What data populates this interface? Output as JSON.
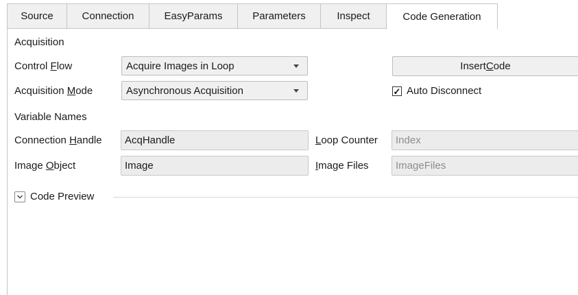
{
  "tabs": [
    {
      "label": "Source"
    },
    {
      "label": "Connection"
    },
    {
      "label": "EasyParams"
    },
    {
      "label": "Parameters"
    },
    {
      "label": "Inspect"
    },
    {
      "label": "Code Generation",
      "active": true
    }
  ],
  "acquisition": {
    "section_label": "Acquisition",
    "control_flow": {
      "label_pre": "Control ",
      "label_key": "F",
      "label_post": "low",
      "value": "Acquire Images in Loop"
    },
    "acquisition_mode": {
      "label_pre": "Acquisition ",
      "label_key": "M",
      "label_post": "ode",
      "value": "Asynchronous Acquisition"
    },
    "insert_code": {
      "pre": "Insert ",
      "key": "C",
      "post": "ode"
    },
    "auto_disconnect": {
      "label": "Auto Disconnect",
      "checked": true,
      "mark": "✓"
    }
  },
  "variable_names": {
    "section_label": "Variable Names",
    "connection_handle": {
      "label_pre": "Connection ",
      "label_key": "H",
      "label_post": "andle",
      "value": "AcqHandle"
    },
    "image_object": {
      "label_pre": "Image ",
      "label_key": "O",
      "label_post": "bject",
      "value": "Image"
    },
    "loop_counter": {
      "label_pre": "",
      "label_key": "L",
      "label_post": "oop Counter",
      "value": "Index"
    },
    "image_files": {
      "label_pre": "",
      "label_key": "I",
      "label_post": "mage Files",
      "value": "ImageFiles"
    }
  },
  "code_preview": {
    "label": "Code Preview",
    "expanded": false
  }
}
